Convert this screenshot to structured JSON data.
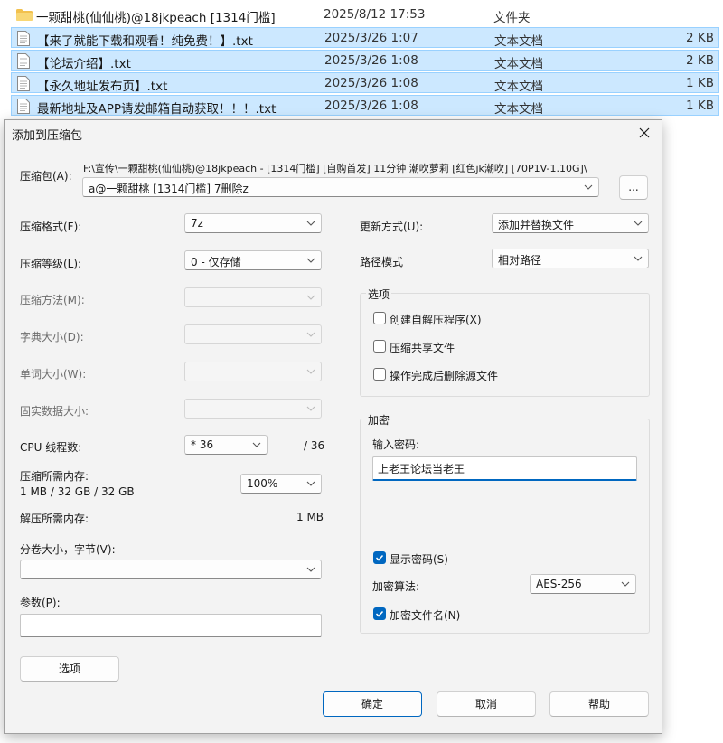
{
  "file_list": {
    "folder": {
      "name": "一颗甜桃(仙仙桃)@18jkpeach [1314门槛]",
      "date": "2025/8/12 17:53",
      "type": "文件夹",
      "size": ""
    },
    "files": [
      {
        "name": "【来了就能下载和观看！纯免费！】.txt",
        "date": "2025/3/26 1:07",
        "type": "文本文档",
        "size": "2 KB"
      },
      {
        "name": "【论坛介绍】.txt",
        "date": "2025/3/26 1:08",
        "type": "文本文档",
        "size": "2 KB"
      },
      {
        "name": "【永久地址发布页】.txt",
        "date": "2025/3/26 1:08",
        "type": "文本文档",
        "size": "1 KB"
      },
      {
        "name": "最新地址及APP请发邮箱自动获取！！！.txt",
        "date": "2025/3/26 1:08",
        "type": "文本文档",
        "size": "1 KB"
      }
    ]
  },
  "dialog": {
    "title": "添加到压缩包",
    "archive": {
      "label": "压缩包(A):",
      "path_line1": "F:\\宣传\\一颗甜桃(仙仙桃)@18jkpeach - [1314门槛] [自购首发] 11分钟 潮吹萝莉 [红色jk潮吹] [70P1V-1.10G]\\",
      "path_value": "a@一颗甜桃 [1314门槛] 7删除z",
      "browse_label": "..."
    },
    "left": {
      "format": {
        "label": "压缩格式(F):",
        "value": "7z"
      },
      "level": {
        "label": "压缩等级(L):",
        "value": "0 - 仅存储"
      },
      "method": {
        "label": "压缩方法(M):",
        "value": ""
      },
      "dict": {
        "label": "字典大小(D):",
        "value": ""
      },
      "word": {
        "label": "单词大小(W):",
        "value": ""
      },
      "solid": {
        "label": "固实数据大小:",
        "value": ""
      },
      "threads": {
        "label": "CPU 线程数:",
        "value": "* 36",
        "max": "/ 36"
      },
      "mem_compress": {
        "label": "压缩所需内存:",
        "detail": "1 MB / 32 GB / 32 GB",
        "value": "100%"
      },
      "mem_decompress": {
        "label": "解压所需内存:",
        "value": "1 MB"
      },
      "volume": {
        "label": "分卷大小，字节(V):",
        "value": ""
      },
      "params": {
        "label": "参数(P):",
        "value": ""
      },
      "options_button": "选项"
    },
    "right": {
      "update": {
        "label": "更新方式(U):",
        "value": "添加并替换文件"
      },
      "path_mode": {
        "label": "路径模式",
        "value": "相对路径"
      },
      "options": {
        "title": "选项",
        "sfx": {
          "label": "创建自解压程序(X)",
          "checked": false
        },
        "shared": {
          "label": "压缩共享文件",
          "checked": false
        },
        "delete": {
          "label": "操作完成后删除源文件",
          "checked": false
        }
      },
      "encryption": {
        "title": "加密",
        "password_label": "输入密码:",
        "password_value": "上老王论坛当老王",
        "show_password": {
          "label": "显示密码(S)",
          "checked": true
        },
        "method": {
          "label": "加密算法:",
          "value": "AES-256"
        },
        "encrypt_names": {
          "label": "加密文件名(N)",
          "checked": true
        }
      }
    },
    "buttons": {
      "ok": "确定",
      "cancel": "取消",
      "help": "帮助"
    }
  },
  "colors": {
    "accent": "#0067c0",
    "selection": "#cce8ff",
    "dialog_bg": "#f3f3f3"
  },
  "icons": [
    "folder-icon",
    "text-file-icon",
    "close-icon",
    "chevron-down-icon",
    "checkmark-icon"
  ]
}
